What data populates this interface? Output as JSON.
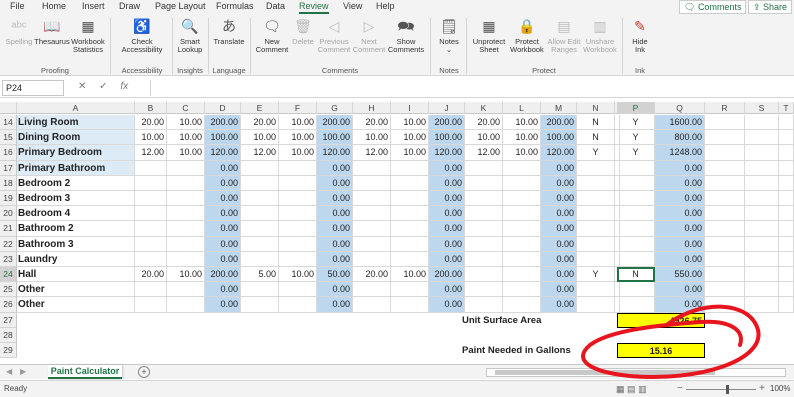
{
  "menu": {
    "items": [
      "File",
      "Home",
      "Insert",
      "Draw",
      "Page Layout",
      "Formulas",
      "Data",
      "Review",
      "View",
      "Help"
    ],
    "active": "Review",
    "comments_btn": "Comments",
    "share_btn": "Share"
  },
  "ribbon": {
    "proofing": {
      "label": "Proofing",
      "spelling": "Spelling",
      "thesaurus": "Thesaurus",
      "workbook_stats_1": "Workbook",
      "workbook_stats_2": "Statistics"
    },
    "accessibility": {
      "label": "Accessibility",
      "check_1": "Check",
      "check_2": "Accessibility"
    },
    "insights": {
      "label": "Insights",
      "smart_1": "Smart",
      "smart_2": "Lookup"
    },
    "language": {
      "label": "Language",
      "translate": "Translate"
    },
    "comments": {
      "label": "Comments",
      "new_1": "New",
      "new_2": "Comment",
      "delete": "Delete",
      "prev_1": "Previous",
      "prev_2": "Comment",
      "next_1": "Next",
      "next_2": "Comment",
      "show_1": "Show",
      "show_2": "Comments"
    },
    "notes": {
      "label": "Notes",
      "notes": "Notes"
    },
    "protect": {
      "label": "Protect",
      "unprotect_1": "Unprotect",
      "unprotect_2": "Sheet",
      "protectwb_1": "Protect",
      "protectwb_2": "Workbook",
      "allow_1": "Allow Edit",
      "allow_2": "Ranges",
      "unshare_1": "Unshare",
      "unshare_2": "Workbook"
    },
    "ink": {
      "label": "Ink",
      "hide_1": "Hide",
      "hide_2": "Ink"
    }
  },
  "formula_bar": {
    "name_box": "P24",
    "fx": "fx",
    "cancel": "✕",
    "enter": "✓",
    "value": ""
  },
  "columns": [
    "A",
    "B",
    "C",
    "D",
    "E",
    "F",
    "G",
    "H",
    "I",
    "J",
    "K",
    "L",
    "M",
    "N",
    "O",
    "P",
    "Q",
    "R",
    "S",
    "T"
  ],
  "rows": [
    {
      "num": "14",
      "a": "Living Room",
      "b": "20.00",
      "c": "10.00",
      "d": "200.00",
      "e": "20.00",
      "f": "10.00",
      "g": "200.00",
      "h": "20.00",
      "i": "10.00",
      "j": "200.00",
      "k": "20.00",
      "l": "10.00",
      "m": "200.00",
      "n": "N",
      "p": "Y",
      "q": "1600.00"
    },
    {
      "num": "15",
      "a": "Dining Room",
      "b": "10.00",
      "c": "10.00",
      "d": "100.00",
      "e": "10.00",
      "f": "10.00",
      "g": "100.00",
      "h": "10.00",
      "i": "10.00",
      "j": "100.00",
      "k": "10.00",
      "l": "10.00",
      "m": "100.00",
      "n": "N",
      "p": "Y",
      "q": "800.00"
    },
    {
      "num": "16",
      "a": "Primary Bedroom",
      "b": "12.00",
      "c": "10.00",
      "d": "120.00",
      "e": "12.00",
      "f": "10.00",
      "g": "120.00",
      "h": "12.00",
      "i": "10.00",
      "j": "120.00",
      "k": "12.00",
      "l": "10.00",
      "m": "120.00",
      "n": "Y",
      "p": "Y",
      "q": "1248.00"
    },
    {
      "num": "17",
      "a": "Primary Bathroom",
      "b": "",
      "c": "",
      "d": "0.00",
      "e": "",
      "f": "",
      "g": "0.00",
      "h": "",
      "i": "",
      "j": "0.00",
      "k": "",
      "l": "",
      "m": "0.00",
      "n": "",
      "p": "",
      "q": "0.00"
    },
    {
      "num": "18",
      "a": "Bedroom 2",
      "b": "",
      "c": "",
      "d": "0.00",
      "e": "",
      "f": "",
      "g": "0.00",
      "h": "",
      "i": "",
      "j": "0.00",
      "k": "",
      "l": "",
      "m": "0.00",
      "n": "",
      "p": "",
      "q": "0.00"
    },
    {
      "num": "19",
      "a": "Bedroom 3",
      "b": "",
      "c": "",
      "d": "0.00",
      "e": "",
      "f": "",
      "g": "0.00",
      "h": "",
      "i": "",
      "j": "0.00",
      "k": "",
      "l": "",
      "m": "0.00",
      "n": "",
      "p": "",
      "q": "0.00"
    },
    {
      "num": "20",
      "a": "Bedroom 4",
      "b": "",
      "c": "",
      "d": "0.00",
      "e": "",
      "f": "",
      "g": "0.00",
      "h": "",
      "i": "",
      "j": "0.00",
      "k": "",
      "l": "",
      "m": "0.00",
      "n": "",
      "p": "",
      "q": "0.00"
    },
    {
      "num": "21",
      "a": "Bathroom 2",
      "b": "",
      "c": "",
      "d": "0.00",
      "e": "",
      "f": "",
      "g": "0.00",
      "h": "",
      "i": "",
      "j": "0.00",
      "k": "",
      "l": "",
      "m": "0.00",
      "n": "",
      "p": "",
      "q": "0.00"
    },
    {
      "num": "22",
      "a": "Bathroom 3",
      "b": "",
      "c": "",
      "d": "0.00",
      "e": "",
      "f": "",
      "g": "0.00",
      "h": "",
      "i": "",
      "j": "0.00",
      "k": "",
      "l": "",
      "m": "0.00",
      "n": "",
      "p": "",
      "q": "0.00"
    },
    {
      "num": "23",
      "a": "Laundry",
      "b": "",
      "c": "",
      "d": "0.00",
      "e": "",
      "f": "",
      "g": "0.00",
      "h": "",
      "i": "",
      "j": "0.00",
      "k": "",
      "l": "",
      "m": "0.00",
      "n": "",
      "p": "",
      "q": "0.00"
    },
    {
      "num": "24",
      "a": "Hall",
      "b": "20.00",
      "c": "10.00",
      "d": "200.00",
      "e": "5.00",
      "f": "10.00",
      "g": "50.00",
      "h": "20.00",
      "i": "10.00",
      "j": "200.00",
      "k": "",
      "l": "",
      "m": "0.00",
      "n": "Y",
      "p": "N",
      "q": "550.00"
    },
    {
      "num": "25",
      "a": "Other",
      "b": "",
      "c": "",
      "d": "0.00",
      "e": "",
      "f": "",
      "g": "0.00",
      "h": "",
      "i": "",
      "j": "0.00",
      "k": "",
      "l": "",
      "m": "0.00",
      "n": "",
      "p": "",
      "q": "0.00"
    },
    {
      "num": "26",
      "a": "Other",
      "b": "",
      "c": "",
      "d": "0.00",
      "e": "",
      "f": "",
      "g": "0.00",
      "h": "",
      "i": "",
      "j": "0.00",
      "k": "",
      "l": "",
      "m": "0.00",
      "n": "",
      "p": "",
      "q": "0.00"
    }
  ],
  "summary": {
    "r27": "27",
    "r28": "28",
    "r29": "29",
    "surface_label": "Unit Surface Area",
    "surface_value": "4926.75",
    "paint_label": "Paint Needed in Gallons",
    "paint_value": "15.16"
  },
  "sheet_tab": "Paint Calculator",
  "add_sheet": "+",
  "status": "Ready",
  "zoom": "100%",
  "colors": {
    "accent": "#217346",
    "blue_col": "#bdd7ee",
    "highlight": "#ffff00",
    "annotation": "#e8141e"
  }
}
